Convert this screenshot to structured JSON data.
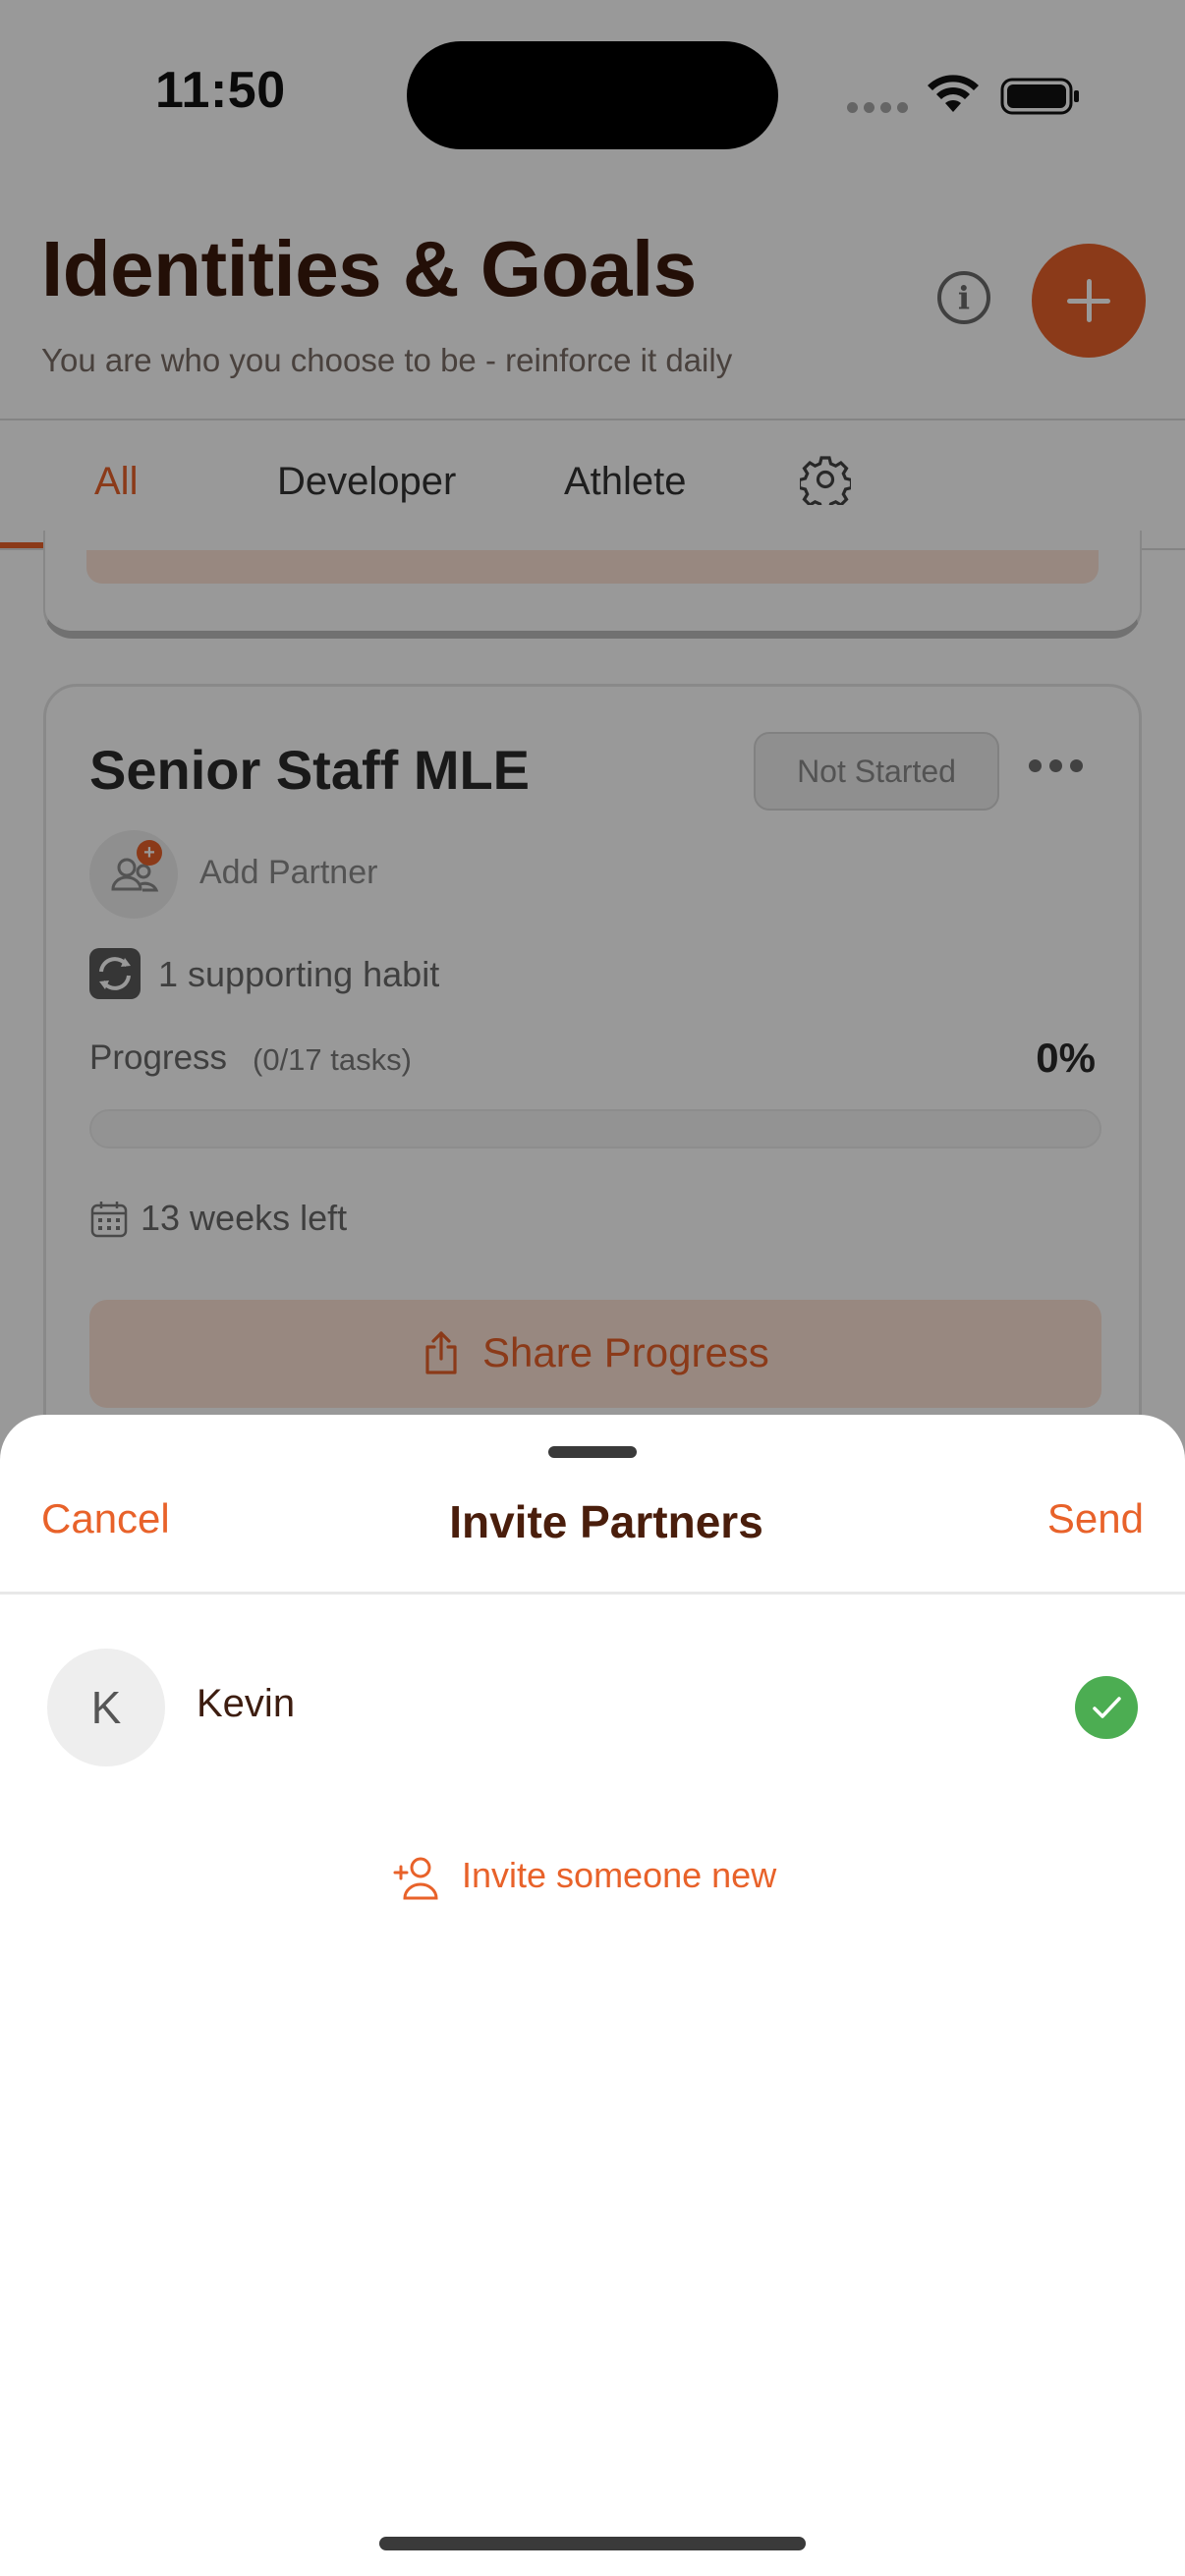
{
  "status_bar": {
    "time": "11:50"
  },
  "header": {
    "title": "Identities & Goals",
    "subtitle": "You are who you choose to be - reinforce it daily",
    "info_icon_glyph": "i",
    "icons": [
      "info-icon",
      "plus-icon"
    ]
  },
  "tabs": [
    {
      "label": "All",
      "active": true
    },
    {
      "label": "Developer",
      "active": false
    },
    {
      "label": "Athlete",
      "active": false
    }
  ],
  "goal_card": {
    "title": "Senior Staff MLE",
    "status": "Not Started",
    "partner_label": "Add Partner",
    "partner_badge": "+",
    "habits": "1 supporting habit",
    "progress_label": "Progress",
    "progress_tasks": "(0/17 tasks)",
    "progress_percent": "0%",
    "progress_value": 0,
    "time_left": "13 weeks left",
    "share_label": "Share Progress"
  },
  "sheet": {
    "cancel_label": "Cancel",
    "title": "Invite Partners",
    "send_label": "Send",
    "contacts": [
      {
        "initial": "K",
        "name": "Kevin",
        "selected": true
      }
    ],
    "invite_new_label": "Invite someone new"
  },
  "colors": {
    "accent": "#e8622a",
    "accent_light": "#fde3d5",
    "title_brown": "#3b1a0c",
    "check_green": "#4cad52"
  }
}
